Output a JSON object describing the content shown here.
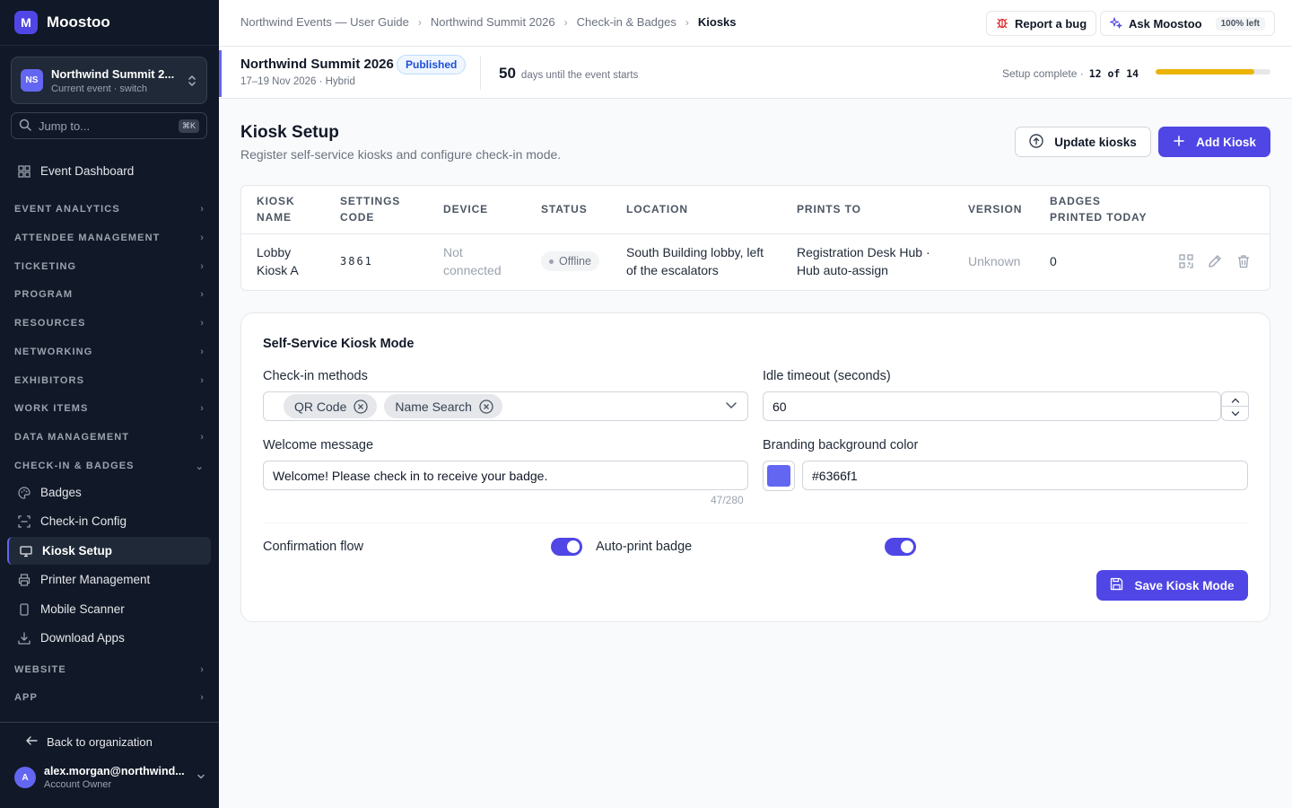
{
  "app": {
    "logo_letter": "M",
    "name": "Moostoo"
  },
  "event_switcher": {
    "initials": "NS",
    "name": "Northwind Summit 2...",
    "subtitle": "Current event · switch"
  },
  "jump": {
    "placeholder": "Jump to...",
    "shortcut": "⌘K"
  },
  "sidebar": {
    "dashboard": "Event Dashboard",
    "sections": [
      "EVENT ANALYTICS",
      "ATTENDEE MANAGEMENT",
      "TICKETING",
      "PROGRAM",
      "RESOURCES",
      "NETWORKING",
      "EXHIBITORS",
      "WORK ITEMS",
      "DATA MANAGEMENT",
      "CHECK-IN & BADGES"
    ],
    "checkin_items": [
      "Badges",
      "Check-in Config",
      "Kiosk Setup",
      "Printer Management",
      "Mobile Scanner",
      "Download Apps"
    ],
    "active_item": "Kiosk Setup",
    "bottom_sections": [
      "WEBSITE",
      "APP"
    ],
    "back": "Back to organization",
    "user": {
      "initial": "A",
      "email": "alex.morgan@northwind...",
      "role": "Account Owner"
    }
  },
  "breadcrumbs": [
    "Northwind Events — User Guide",
    "Northwind Summit 2026",
    "Check-in & Badges",
    "Kiosks"
  ],
  "topbar": {
    "report_bug": "Report a bug",
    "ask": "Ask Moostoo",
    "credits": "100% left"
  },
  "event": {
    "title": "Northwind Summit 2026",
    "status": "Published",
    "dates": "17–19 Nov 2026 · Hybrid",
    "days_until": "50",
    "days_label": "days until the event starts",
    "setup_label": "Setup complete ·",
    "setup_count": "12 of 14",
    "setup_progress": 0.857
  },
  "page": {
    "title": "Kiosk Setup",
    "subtitle": "Register self-service kiosks and configure check-in mode.",
    "update_button": "Update kiosks",
    "add_button": "Add Kiosk"
  },
  "table": {
    "headers": {
      "kiosk_name": [
        "KIOSK",
        "NAME"
      ],
      "settings_code": [
        "SETTINGS",
        "CODE"
      ],
      "device": "DEVICE",
      "status": "STATUS",
      "location": "LOCATION",
      "prints_to": "PRINTS TO",
      "version": "VERSION",
      "badges": [
        "BADGES",
        "PRINTED TODAY"
      ]
    },
    "rows": [
      {
        "name": [
          "Lobby",
          "Kiosk A"
        ],
        "code": "3861",
        "device": [
          "Not",
          "connected"
        ],
        "status": "Offline",
        "location": [
          "South Building lobby, left",
          "of the escalators"
        ],
        "prints_to": [
          "Registration Desk Hub ·",
          "Hub auto-assign"
        ],
        "version": "Unknown",
        "badges": "0"
      }
    ]
  },
  "kiosk_mode": {
    "title": "Self-Service Kiosk Mode",
    "checkin_label": "Check-in methods",
    "methods": [
      "QR Code",
      "Name Search"
    ],
    "timeout_label": "Idle timeout (seconds)",
    "timeout_value": "60",
    "welcome_label": "Welcome message",
    "welcome_value": "Welcome! Please check in to receive your badge.",
    "welcome_count": "47/280",
    "color_label": "Branding background color",
    "color_value": "#6366f1",
    "confirmation_label": "Confirmation flow",
    "confirmation_on": true,
    "autoprint_label": "Auto-print badge",
    "autoprint_on": true,
    "save_button": "Save Kiosk Mode"
  },
  "colors": {
    "accent": "#4f46e5",
    "sidebar_bg": "#111827",
    "progress": "#eab308",
    "swatch": "#6366f1"
  }
}
